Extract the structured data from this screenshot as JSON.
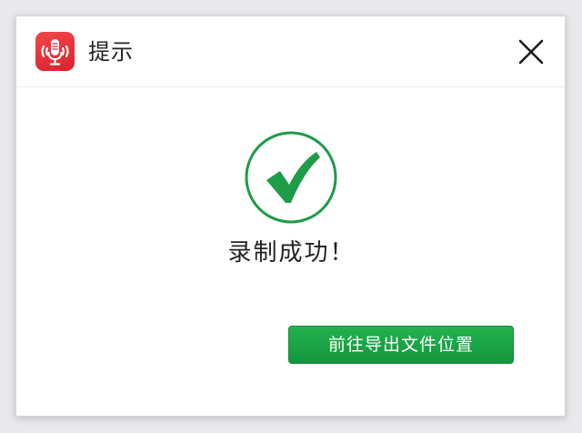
{
  "dialog": {
    "title": "提示",
    "app_icon": "microphone-recorder-icon",
    "close_icon": "close-icon",
    "status_icon": "success-check-icon",
    "message": "录制成功！",
    "action_label": "前往导出文件位置"
  },
  "colors": {
    "accent_green": "#1aa548",
    "check_green": "#1a9a45",
    "app_icon_red": "#e3303a"
  }
}
